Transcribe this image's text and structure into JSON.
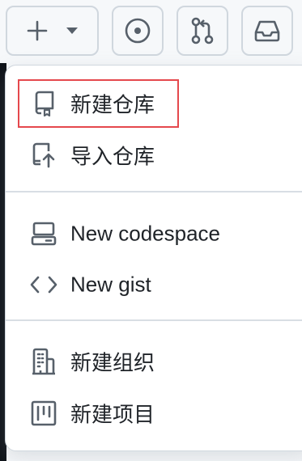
{
  "header": {
    "new_button_icon": "plus-icon",
    "dropdown_icon": "triangle-down-icon",
    "copilot_icon": "copilot-icon",
    "pull_requests_icon": "git-pull-request-icon",
    "inbox_icon": "inbox-icon"
  },
  "menu": {
    "items": [
      {
        "label": "新建仓库",
        "icon": "repo-icon"
      },
      {
        "label": "导入仓库",
        "icon": "repo-push-icon"
      },
      {
        "label": "New codespace",
        "icon": "codespaces-icon"
      },
      {
        "label": "New gist",
        "icon": "code-icon"
      },
      {
        "label": "新建组织",
        "icon": "organization-icon"
      },
      {
        "label": "新建项目",
        "icon": "project-icon"
      }
    ]
  },
  "colors": {
    "highlight": "#e5484d",
    "text": "#1f2328",
    "icon": "#57606a",
    "border": "#d0d7de"
  }
}
